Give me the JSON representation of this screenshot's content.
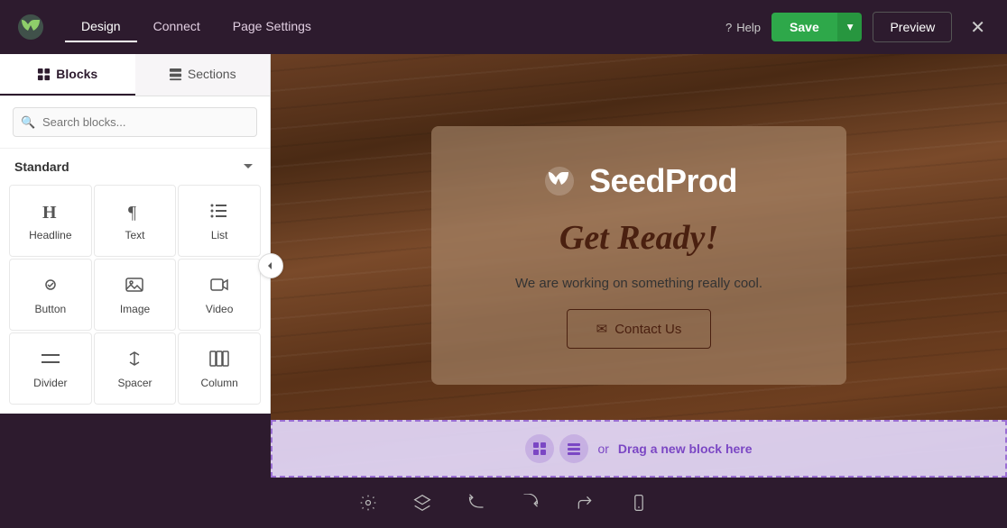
{
  "topbar": {
    "nav_items": [
      {
        "label": "Design",
        "active": true
      },
      {
        "label": "Connect",
        "active": false
      },
      {
        "label": "Page Settings",
        "active": false
      }
    ],
    "help_label": "Help",
    "save_label": "Save",
    "preview_label": "Preview"
  },
  "panel": {
    "tabs": [
      {
        "id": "blocks",
        "label": "Blocks",
        "active": true
      },
      {
        "id": "sections",
        "label": "Sections",
        "active": false
      }
    ],
    "search_placeholder": "Search blocks...",
    "section_title": "Standard",
    "blocks": [
      {
        "id": "headline",
        "label": "Headline",
        "icon": "H"
      },
      {
        "id": "text",
        "label": "Text",
        "icon": "¶"
      },
      {
        "id": "list",
        "label": "List",
        "icon": "list"
      },
      {
        "id": "button",
        "label": "Button",
        "icon": "button"
      },
      {
        "id": "image",
        "label": "Image",
        "icon": "image"
      },
      {
        "id": "video",
        "label": "Video",
        "icon": "video"
      },
      {
        "id": "divider",
        "label": "Divider",
        "icon": "divider"
      },
      {
        "id": "spacer",
        "label": "Spacer",
        "icon": "spacer"
      },
      {
        "id": "column",
        "label": "Column",
        "icon": "column"
      }
    ]
  },
  "canvas": {
    "card": {
      "logo_text": "SeedProd",
      "tagline": "Get Ready!",
      "subtitle": "We are working on something really cool.",
      "cta_label": "Contact Us"
    }
  },
  "drop_zone": {
    "or_text": "or",
    "drag_label": "Drag a new block here"
  },
  "toolbar": {
    "buttons": [
      "settings",
      "layers",
      "history-back",
      "history-forward",
      "redo",
      "mobile"
    ]
  }
}
